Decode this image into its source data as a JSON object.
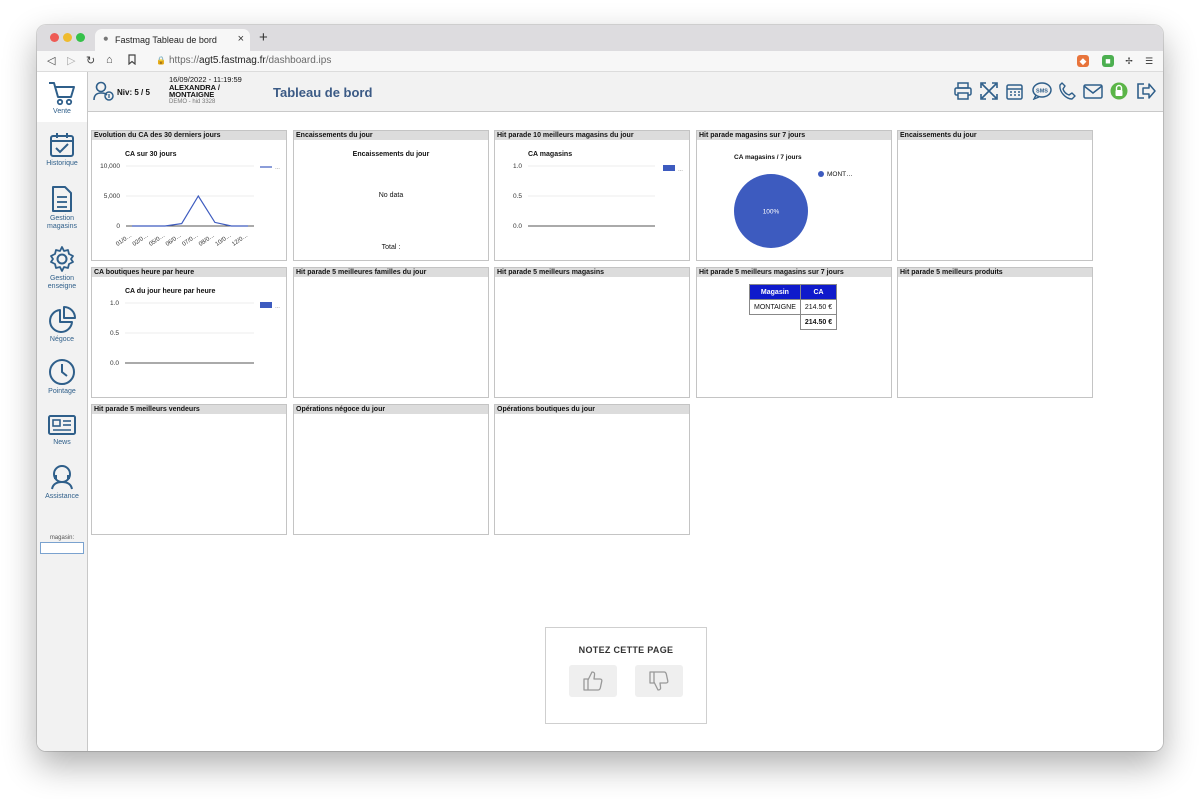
{
  "browser": {
    "tab_title": "Fastmag Tableau de bord",
    "url_prefix": "https://",
    "url_domain": "agt5.fastmag.fr",
    "url_path": "/dashboard.ips"
  },
  "sidebar": {
    "items": [
      {
        "label": "Vente",
        "icon": "cart-icon"
      },
      {
        "label": "Historique",
        "icon": "calendar-check-icon"
      },
      {
        "label": "Gestion magasins",
        "icon": "document-icon"
      },
      {
        "label": "Gestion enseigne",
        "icon": "gear-icon"
      },
      {
        "label": "Négoce",
        "icon": "pie-chart-icon"
      },
      {
        "label": "Pointage",
        "icon": "clock-icon"
      },
      {
        "label": "News",
        "icon": "newspaper-icon"
      },
      {
        "label": "Assistance",
        "icon": "headset-icon"
      }
    ],
    "magasin_label": "magasin:",
    "magasin_value": ""
  },
  "header": {
    "niv": "Niv: 5 / 5",
    "datetime": "16/09/2022 - 11:19:59",
    "user_line1": "ALEXANDRA /",
    "user_line2": "MONTAIGNE",
    "demo": "DEMO - hid 3328",
    "title": "Tableau de bord",
    "icons": [
      "printer-icon",
      "fullscreen-icon",
      "calendar-icon",
      "sms-icon",
      "phone-icon",
      "mail-icon",
      "lock-icon",
      "logout-icon"
    ]
  },
  "widgets": [
    {
      "title": "Evolution du CA des 30 derniers jours"
    },
    {
      "title": "Encaissements du jour"
    },
    {
      "title": "Hit parade 10 meilleurs magasins du jour"
    },
    {
      "title": "Hit parade magasins sur 7 jours"
    },
    {
      "title": "Encaissements du jour"
    },
    {
      "title": "CA boutiques heure par heure"
    },
    {
      "title": "Hit parade 5 meilleures familles du jour"
    },
    {
      "title": "Hit parade 5 meilleurs magasins"
    },
    {
      "title": "Hit parade 5 meilleurs magasins sur 7 jours"
    },
    {
      "title": "Hit parade 5 meilleurs produits"
    },
    {
      "title": "Hit parade 5 meilleurs vendeurs"
    },
    {
      "title": "Opérations négoce du jour"
    },
    {
      "title": "Opérations boutiques du jour"
    }
  ],
  "encaissements": {
    "title": "Encaissements du jour",
    "no_data": "No data",
    "total": "Total :"
  },
  "mini_table": {
    "headers": [
      "Magasin",
      "CA"
    ],
    "rows": [
      [
        "MONTAIGNE",
        "214.50 €"
      ]
    ],
    "total": "214.50 €"
  },
  "rating": {
    "title": "NOTEZ CETTE PAGE"
  },
  "chart_data": [
    {
      "type": "line",
      "title": "CA sur 30 jours",
      "categories": [
        "01/0…",
        "02/0…",
        "05/0…",
        "06/0…",
        "07/0…",
        "08/0…",
        "10/0…",
        "12/0…"
      ],
      "values": [
        0,
        0,
        0,
        400,
        5000,
        600,
        0,
        0
      ],
      "ylim": [
        0,
        10000
      ],
      "yticks": [
        "10,000",
        "5,000",
        "0"
      ],
      "legend": "…",
      "color": "#3d5bbf"
    },
    {
      "type": "bar",
      "title": "CA magasins",
      "categories": [],
      "values": [],
      "ylim": [
        0,
        1
      ],
      "yticks": [
        "1.0",
        "0.5",
        "0.0"
      ],
      "legend": "…",
      "color": "#3d5bbf"
    },
    {
      "type": "pie",
      "title": "CA magasins / 7 jours",
      "slices": [
        {
          "name": "MONT…",
          "value": 100,
          "label": "100%"
        }
      ],
      "color": "#3d5bbf"
    },
    {
      "type": "line",
      "title": "CA du jour heure par heure",
      "categories": [],
      "values": [],
      "ylim": [
        0,
        1
      ],
      "yticks": [
        "1.0",
        "0.5",
        "0.0"
      ],
      "legend": "…",
      "color": "#3d5bbf"
    }
  ]
}
